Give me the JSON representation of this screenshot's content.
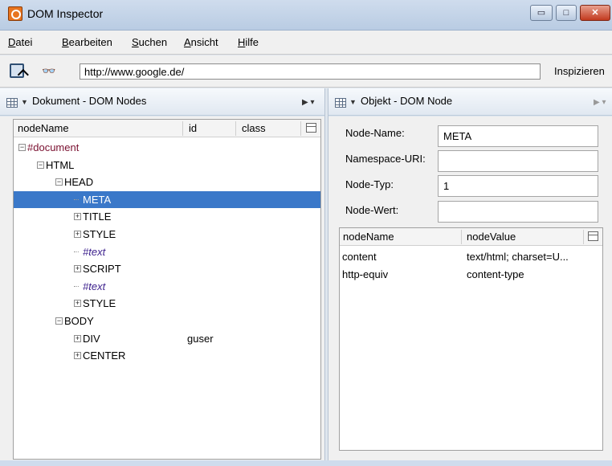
{
  "window": {
    "title": "DOM Inspector",
    "minimize_glyph": "▭",
    "maximize_glyph": "□",
    "close_glyph": "✕"
  },
  "menubar": {
    "items": [
      "Datei",
      "Bearbeiten",
      "Suchen",
      "Ansicht",
      "Hilfe"
    ]
  },
  "toolbar": {
    "url_value": "http://www.google.de/",
    "inspect_label": "Inspizieren",
    "binoculars_glyph": "👓"
  },
  "left_panel": {
    "title": "Dokument - DOM Nodes",
    "columns": [
      "nodeName",
      "id",
      "class"
    ],
    "rows": [
      {
        "label": "#document",
        "kind": "doc",
        "expander": "−",
        "id": ""
      },
      {
        "label": "HTML",
        "kind": "el",
        "expander": "−",
        "id": ""
      },
      {
        "label": "HEAD",
        "kind": "el",
        "expander": "−",
        "id": ""
      },
      {
        "label": "META",
        "kind": "el",
        "expander": "",
        "id": "",
        "selected": true
      },
      {
        "label": "TITLE",
        "kind": "el",
        "expander": "+",
        "id": ""
      },
      {
        "label": "STYLE",
        "kind": "el",
        "expander": "+",
        "id": ""
      },
      {
        "label": "#text",
        "kind": "text",
        "expander": "",
        "id": ""
      },
      {
        "label": "SCRIPT",
        "kind": "el",
        "expander": "+",
        "id": ""
      },
      {
        "label": "#text",
        "kind": "text",
        "expander": "",
        "id": ""
      },
      {
        "label": "STYLE",
        "kind": "el",
        "expander": "+",
        "id": ""
      },
      {
        "label": "BODY",
        "kind": "el",
        "expander": "−",
        "id": ""
      },
      {
        "label": "DIV",
        "kind": "el",
        "expander": "+",
        "id": "guser"
      },
      {
        "label": "CENTER",
        "kind": "el",
        "expander": "+",
        "id": ""
      }
    ]
  },
  "right_panel": {
    "title": "Objekt - DOM Node",
    "fields": [
      {
        "label": "Node-Name:",
        "value": "META"
      },
      {
        "label": "Namespace-URI:",
        "value": ""
      },
      {
        "label": "Node-Typ:",
        "value": "1"
      },
      {
        "label": "Node-Wert:",
        "value": ""
      }
    ],
    "attr_columns": [
      "nodeName",
      "nodeValue"
    ],
    "attributes": [
      {
        "name": "content",
        "value": "text/html; charset=U..."
      },
      {
        "name": "http-equiv",
        "value": "content-type"
      }
    ]
  }
}
